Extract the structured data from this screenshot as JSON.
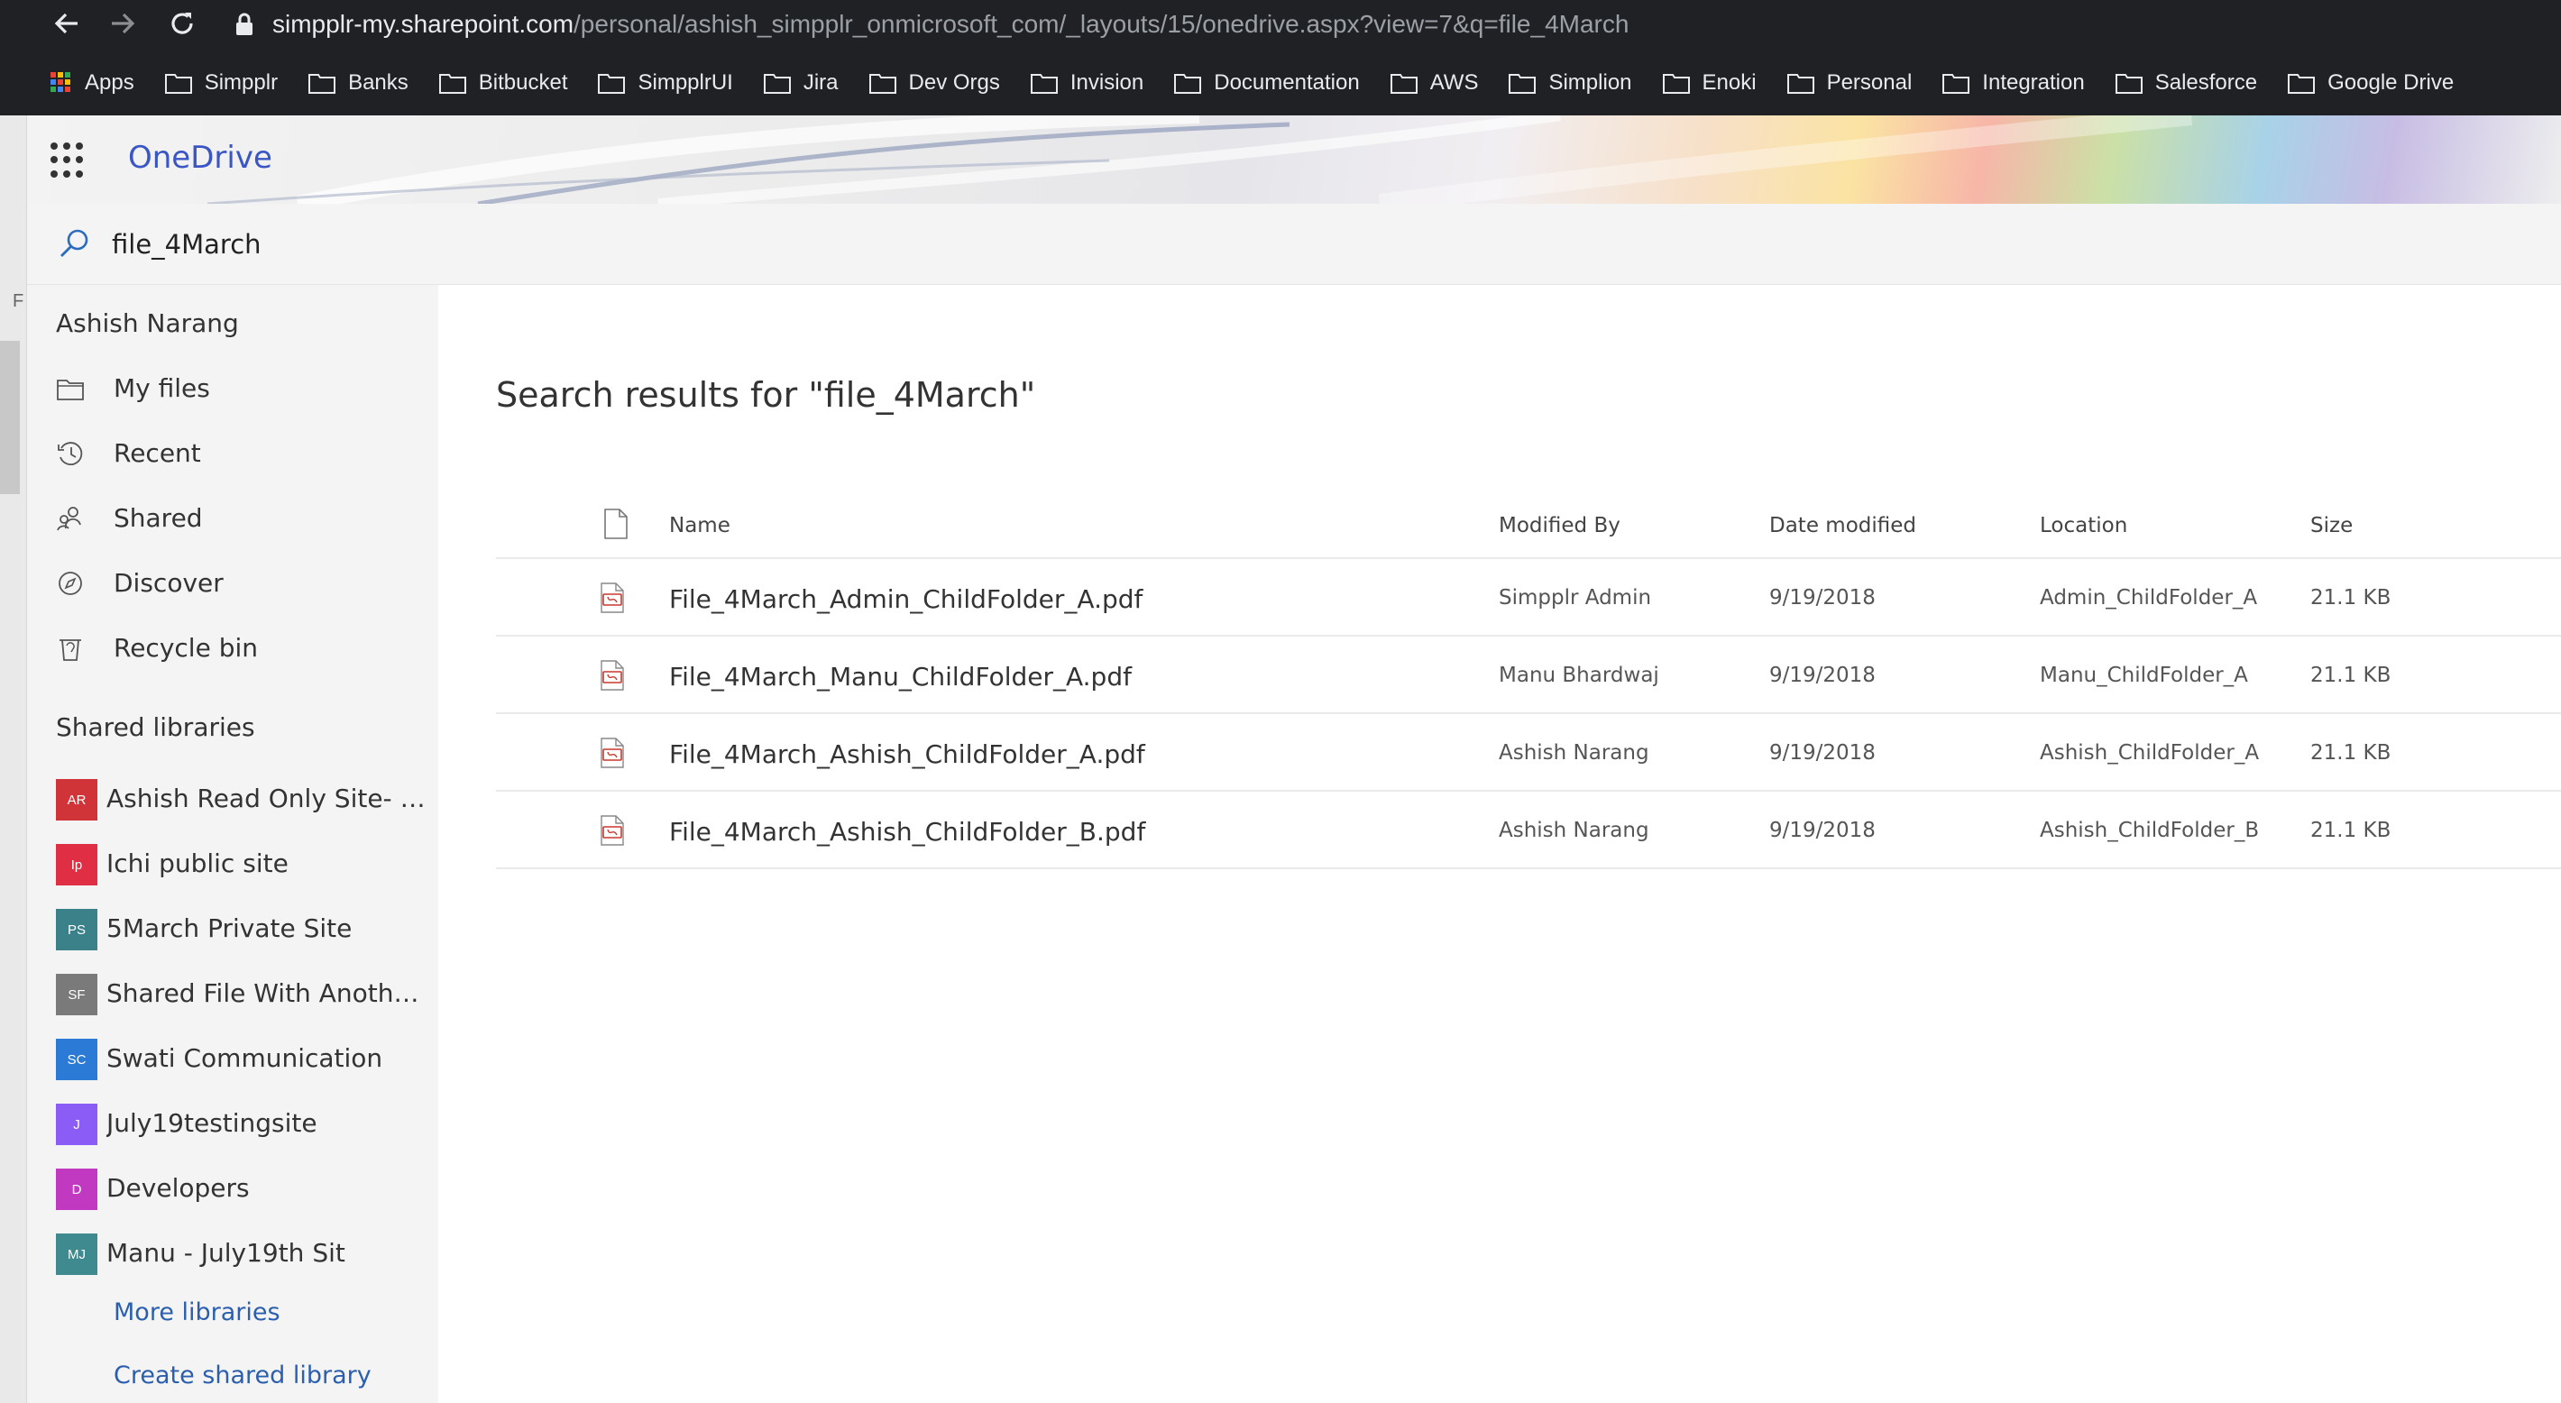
{
  "browser": {
    "url_host": "simpplr-my.sharepoint.com",
    "url_path": "/personal/ashish_simpplr_onmicrosoft_com/_layouts/15/onedrive.aspx?view=7&q=file_4March",
    "bookmarks": [
      "Apps",
      "Simpplr",
      "Banks",
      "Bitbucket",
      "SimpplrUI",
      "Jira",
      "Dev Orgs",
      "Invision",
      "Documentation",
      "AWS",
      "Simplion",
      "Enoki",
      "Personal",
      "Integration",
      "Salesforce",
      "Google Drive"
    ]
  },
  "left_strip_text": "F",
  "app": {
    "title": "OneDrive"
  },
  "search": {
    "query": "file_4March"
  },
  "sidebar": {
    "user_name": "Ashish Narang",
    "nav": [
      {
        "label": "My files",
        "icon": "folder-icon"
      },
      {
        "label": "Recent",
        "icon": "clock-icon"
      },
      {
        "label": "Shared",
        "icon": "people-icon"
      },
      {
        "label": "Discover",
        "icon": "compass-icon"
      },
      {
        "label": "Recycle bin",
        "icon": "recycle-bin-icon"
      }
    ],
    "shared_libraries_heading": "Shared libraries",
    "libraries": [
      {
        "initials": "AR",
        "label": "Ashish Read Only Site- Ashish Narang",
        "color": "#d13438"
      },
      {
        "initials": "Ip",
        "label": "Ichi public site",
        "color": "#e02f44"
      },
      {
        "initials": "PS",
        "label": "5March Private Site",
        "color": "#3b8189"
      },
      {
        "initials": "SF",
        "label": "Shared File With Another User",
        "color": "#7a7a7a"
      },
      {
        "initials": "SC",
        "label": "Swati Communication",
        "color": "#2b7bd6"
      },
      {
        "initials": "J",
        "label": "July19testingsite",
        "color": "#8b5cf6"
      },
      {
        "initials": "D",
        "label": "Developers",
        "color": "#c239c1"
      },
      {
        "initials": "MJ",
        "label": "Manu - July19th Sit",
        "color": "#3f8a8f"
      }
    ],
    "more_libraries": "More libraries",
    "create_shared_library": "Create shared library"
  },
  "main": {
    "results_title": "Search results for \"file_4March\"",
    "columns": {
      "name": "Name",
      "modified_by": "Modified By",
      "date_modified": "Date modified",
      "location": "Location",
      "size": "Size"
    },
    "rows": [
      {
        "name": "File_4March_Admin_ChildFolder_A.pdf",
        "modified_by": "Simpplr Admin",
        "date_modified": "9/19/2018",
        "location": "Admin_ChildFolder_A",
        "size": "21.1 KB"
      },
      {
        "name": "File_4March_Manu_ChildFolder_A.pdf",
        "modified_by": "Manu Bhardwaj",
        "date_modified": "9/19/2018",
        "location": "Manu_ChildFolder_A",
        "size": "21.1 KB"
      },
      {
        "name": "File_4March_Ashish_ChildFolder_A.pdf",
        "modified_by": "Ashish Narang",
        "date_modified": "9/19/2018",
        "location": "Ashish_ChildFolder_A",
        "size": "21.1 KB"
      },
      {
        "name": "File_4March_Ashish_ChildFolder_B.pdf",
        "modified_by": "Ashish Narang",
        "date_modified": "9/19/2018",
        "location": "Ashish_ChildFolder_B",
        "size": "21.1 KB"
      }
    ]
  }
}
